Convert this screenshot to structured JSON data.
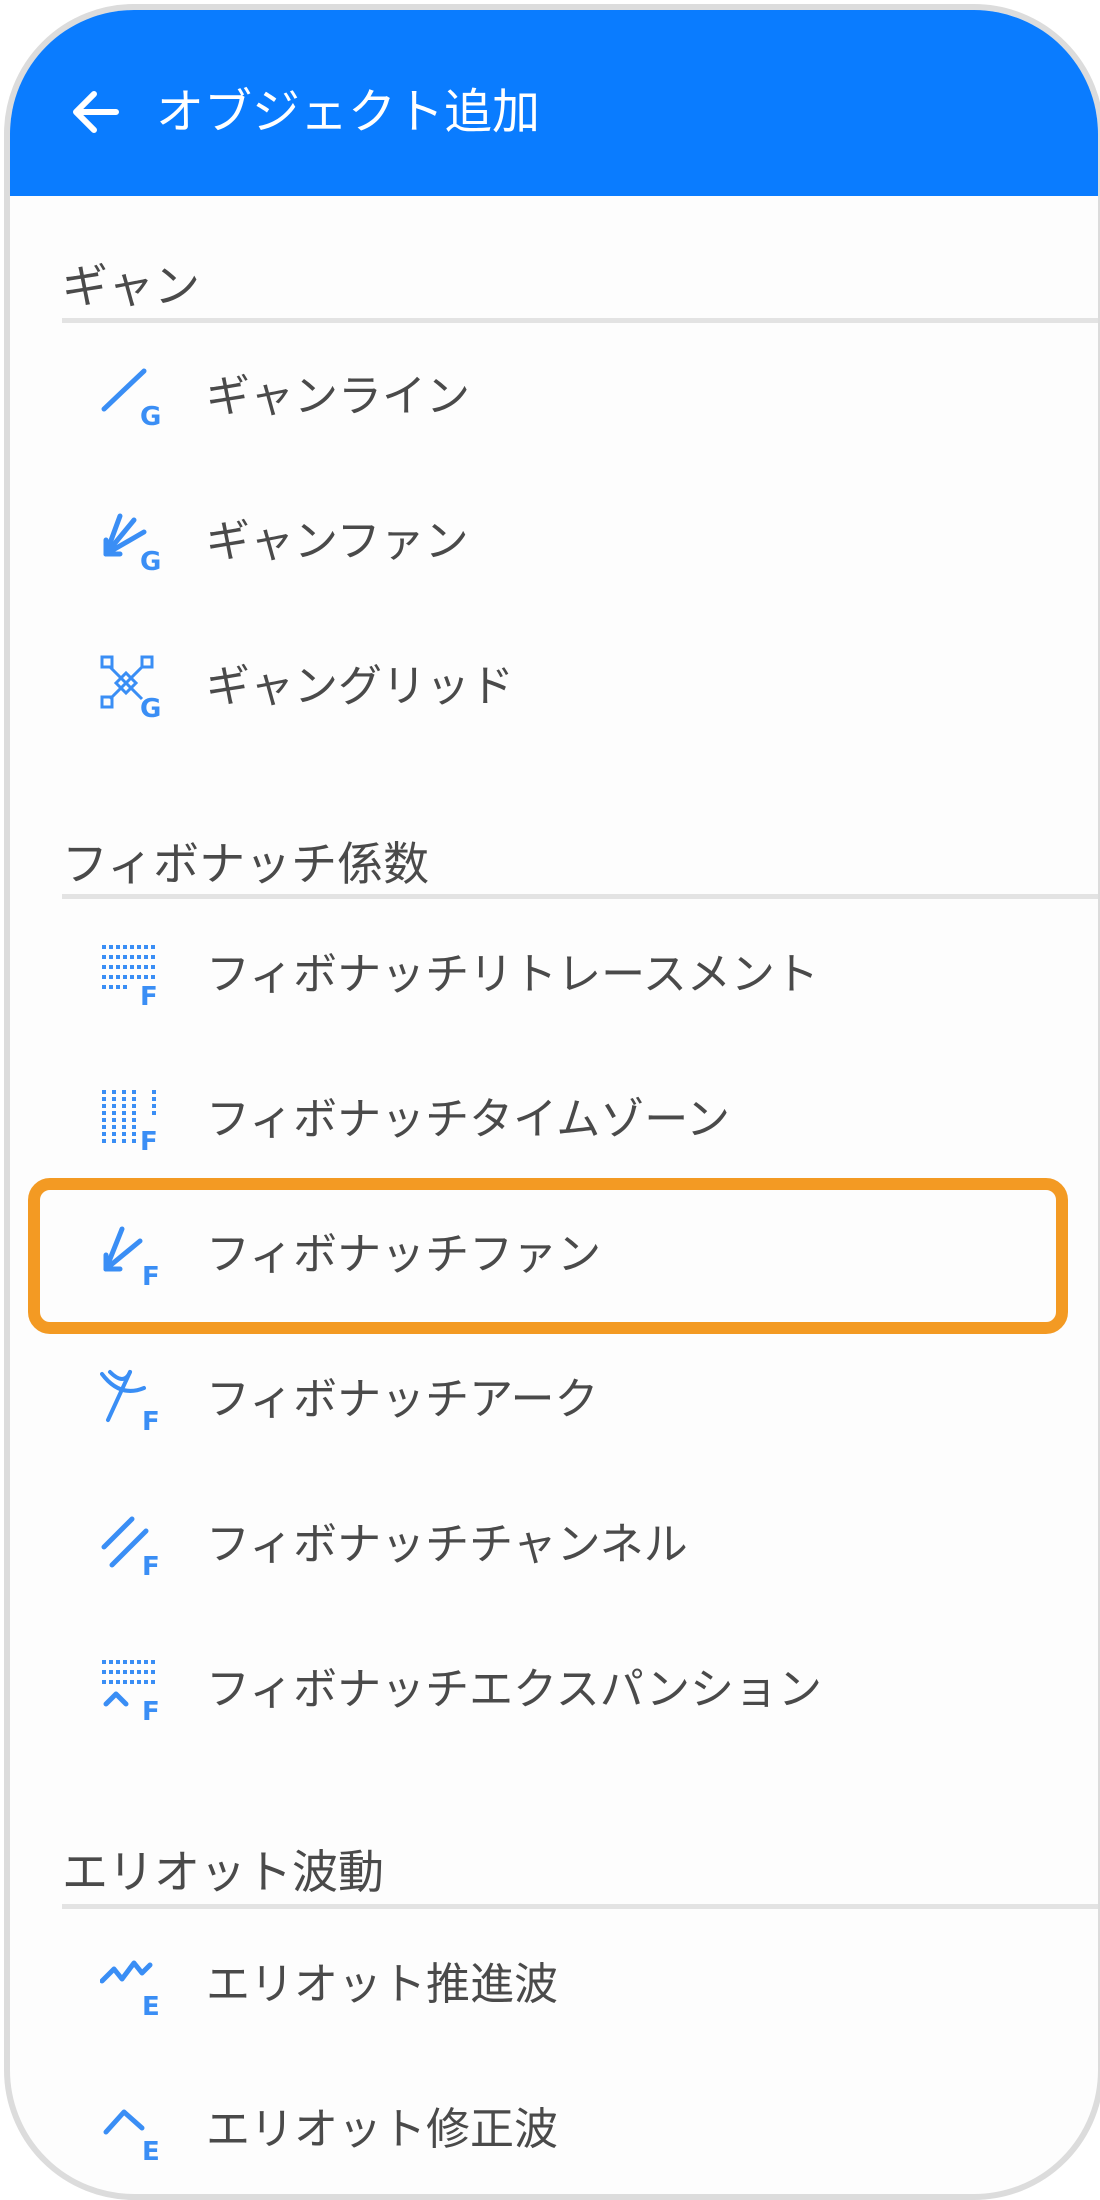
{
  "header": {
    "title": "オブジェクト追加",
    "back_icon": "arrow-left-icon",
    "background_color": "#0a7cff"
  },
  "sections": [
    {
      "title": "ギャン",
      "items": [
        {
          "label": "ギャンライン",
          "icon": "gann-line-icon"
        },
        {
          "label": "ギャンファン",
          "icon": "gann-fan-icon"
        },
        {
          "label": "ギャングリッド",
          "icon": "gann-grid-icon"
        }
      ]
    },
    {
      "title": "フィボナッチ係数",
      "items": [
        {
          "label": "フィボナッチリトレースメント",
          "icon": "fibonacci-retracement-icon"
        },
        {
          "label": "フィボナッチタイムゾーン",
          "icon": "fibonacci-timezone-icon"
        },
        {
          "label": "フィボナッチファン",
          "icon": "fibonacci-fan-icon",
          "highlighted": true
        },
        {
          "label": "フィボナッチアーク",
          "icon": "fibonacci-arc-icon"
        },
        {
          "label": "フィボナッチチャンネル",
          "icon": "fibonacci-channel-icon"
        },
        {
          "label": "フィボナッチエクスパンション",
          "icon": "fibonacci-expansion-icon"
        }
      ]
    },
    {
      "title": "エリオット波動",
      "items": [
        {
          "label": "エリオット推進波",
          "icon": "elliott-impulse-wave-icon"
        },
        {
          "label": "エリオット修正波",
          "icon": "elliott-corrective-wave-icon"
        }
      ]
    }
  ],
  "colors": {
    "icon": "#3a8ef5",
    "highlight": "#f39a23",
    "text": "#4a4a4a"
  }
}
